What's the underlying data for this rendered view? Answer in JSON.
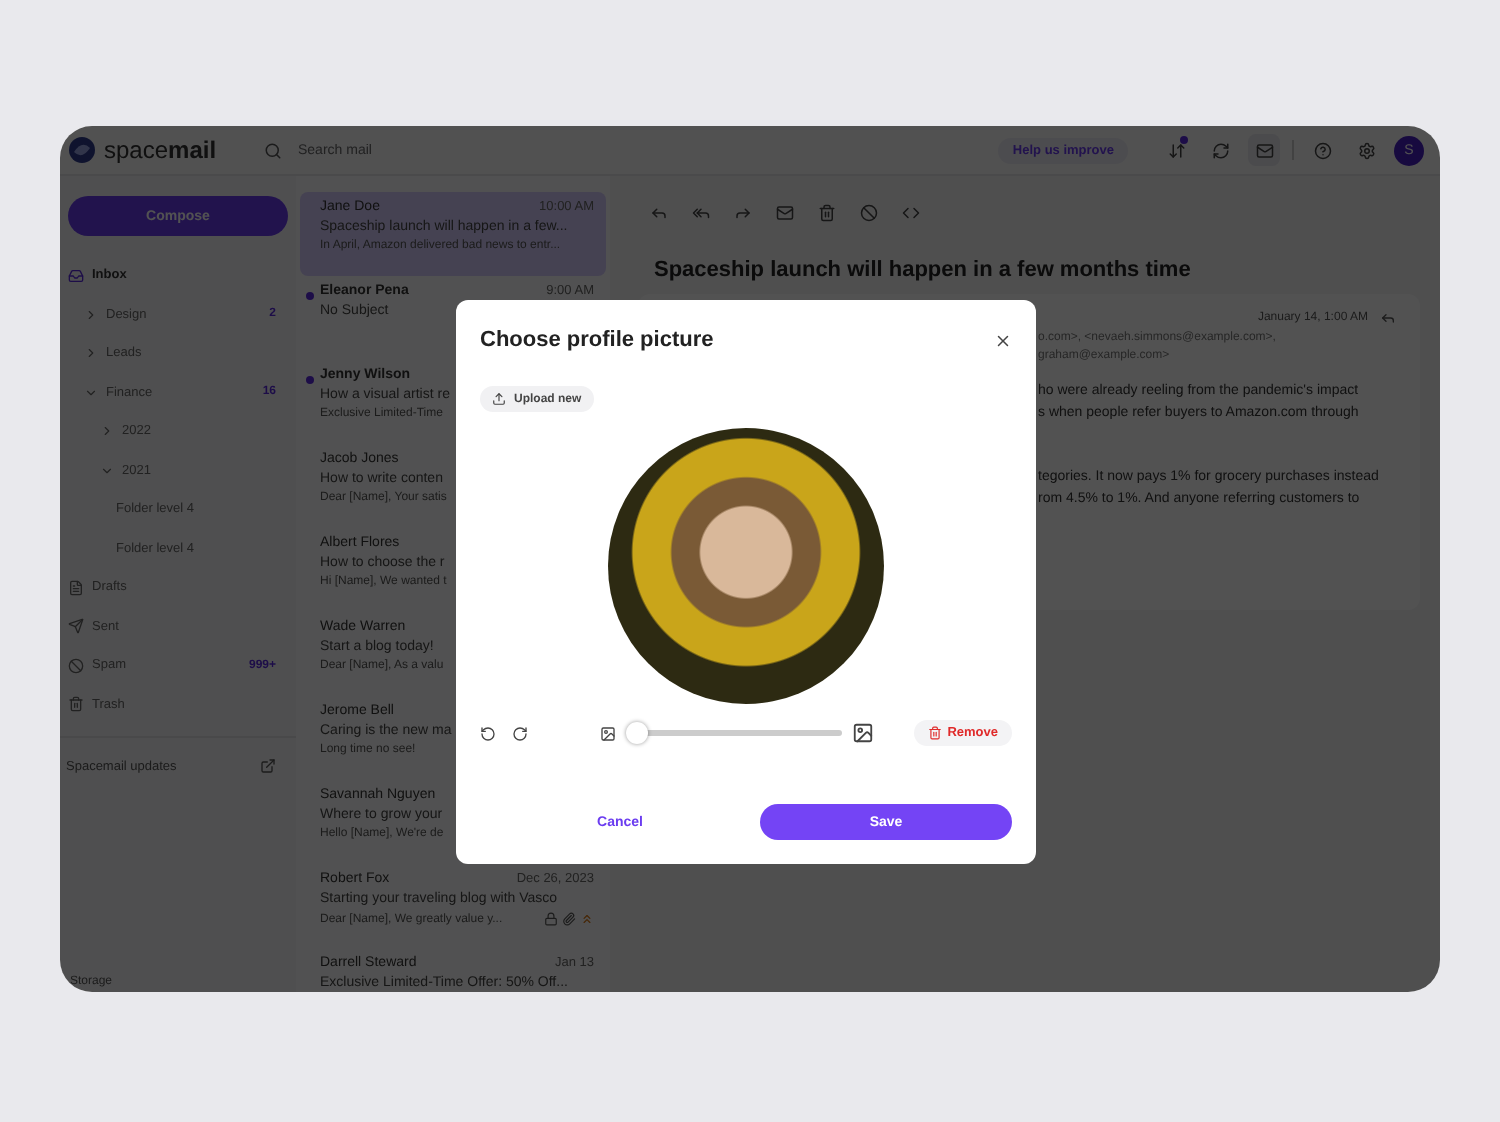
{
  "app": {
    "logo": "space**mail**",
    "search": {
      "placeholder": "Search mail"
    },
    "help_button": "Help us improve",
    "avatar": "S"
  },
  "sidebar": {
    "compose": "Compose",
    "items": [
      {
        "label": "Inbox",
        "selected": true,
        "children": [
          {
            "label": "Design",
            "count": "2",
            "expanded": false,
            "selected": false
          },
          {
            "label": "Leads",
            "expanded": false,
            "selected": false
          },
          {
            "label": "Finance",
            "count": "16",
            "expanded": true,
            "selected": false,
            "children": [
              {
                "label": "2022",
                "expanded": false,
                "selected": false
              },
              {
                "label": "2021",
                "expanded": true,
                "selected": false,
                "children": [
                  {
                    "label": "Folder level 4",
                    "selected": false
                  },
                  {
                    "label": "Folder level 4",
                    "selected": false
                  }
                ]
              }
            ]
          }
        ]
      },
      {
        "label": "Drafts",
        "selected": false
      },
      {
        "label": "Sent",
        "selected": false
      },
      {
        "label": "Spam",
        "count": "999+",
        "selected": false
      },
      {
        "label": "Trash",
        "selected": false
      }
    ],
    "updates": "Spacemail updates",
    "storage": "Storage"
  },
  "mail_list": [
    {
      "sender": "Jane Doe",
      "time": "10:00 AM",
      "subject": "Spaceship launch will happen in a few...",
      "preview": "In April, Amazon delivered bad news to entr...",
      "unread": false,
      "selected": true
    },
    {
      "sender": "Eleanor Pena",
      "time": "9:00 AM",
      "subject": "No Subject",
      "unread": true,
      "selected": false
    },
    {
      "sender": "Jenny Wilson",
      "subject": "How a visual artist re",
      "preview": "Exclusive Limited-Time",
      "unread": true,
      "selected": false
    },
    {
      "sender": "Jacob Jones",
      "subject": "How to write conten",
      "preview": "Dear [Name], Your satis",
      "unread": false,
      "selected": false
    },
    {
      "sender": "Albert Flores",
      "subject": "How to choose the r",
      "preview": "Hi [Name], We wanted t",
      "unread": false,
      "selected": false
    },
    {
      "sender": "Wade Warren",
      "subject": "Start a blog today!",
      "preview": "Dear [Name], As a valu",
      "unread": false,
      "selected": false
    },
    {
      "sender": "Jerome Bell",
      "subject": "Caring is the new ma",
      "preview": "Long time no see!",
      "unread": false,
      "selected": false
    },
    {
      "sender": "Savannah Nguyen",
      "subject": "Where to grow your",
      "preview": "Hello [Name], We're de",
      "unread": false,
      "selected": false
    },
    {
      "sender": "Robert Fox",
      "time": "Dec 26, 2023",
      "subject": "Starting your traveling blog with Vasco",
      "preview": "Dear [Name], We greatly value y...",
      "locked": true,
      "attachment": true,
      "priority": true,
      "unread": false,
      "selected": false
    },
    {
      "sender": "Darrell Steward",
      "time": "Jan 13",
      "subject": "Exclusive Limited-Time Offer: 50% Off...",
      "unread": false,
      "selected": false
    }
  ],
  "message": {
    "title": "Spaceship launch will happen in a few months time",
    "date": "January 14, 1:00 AM",
    "recipients": [
      "o.com>, <nevaeh.simmons@example.com>,",
      "graham@example.com>"
    ],
    "body": [
      [
        "ho were already reeling from the pandemic's impact",
        "s when people refer buyers to Amazon.com through"
      ],
      [
        "tegories. It now pays 1% for grocery purchases instead",
        "rom 4.5% to 1%. And anyone referring customers to"
      ]
    ]
  },
  "dialog": {
    "title": "Choose profile picture",
    "upload": "Upload new",
    "zoom": {
      "level": 0
    },
    "remove": "Remove",
    "cancel": "Cancel",
    "save": "Save"
  }
}
